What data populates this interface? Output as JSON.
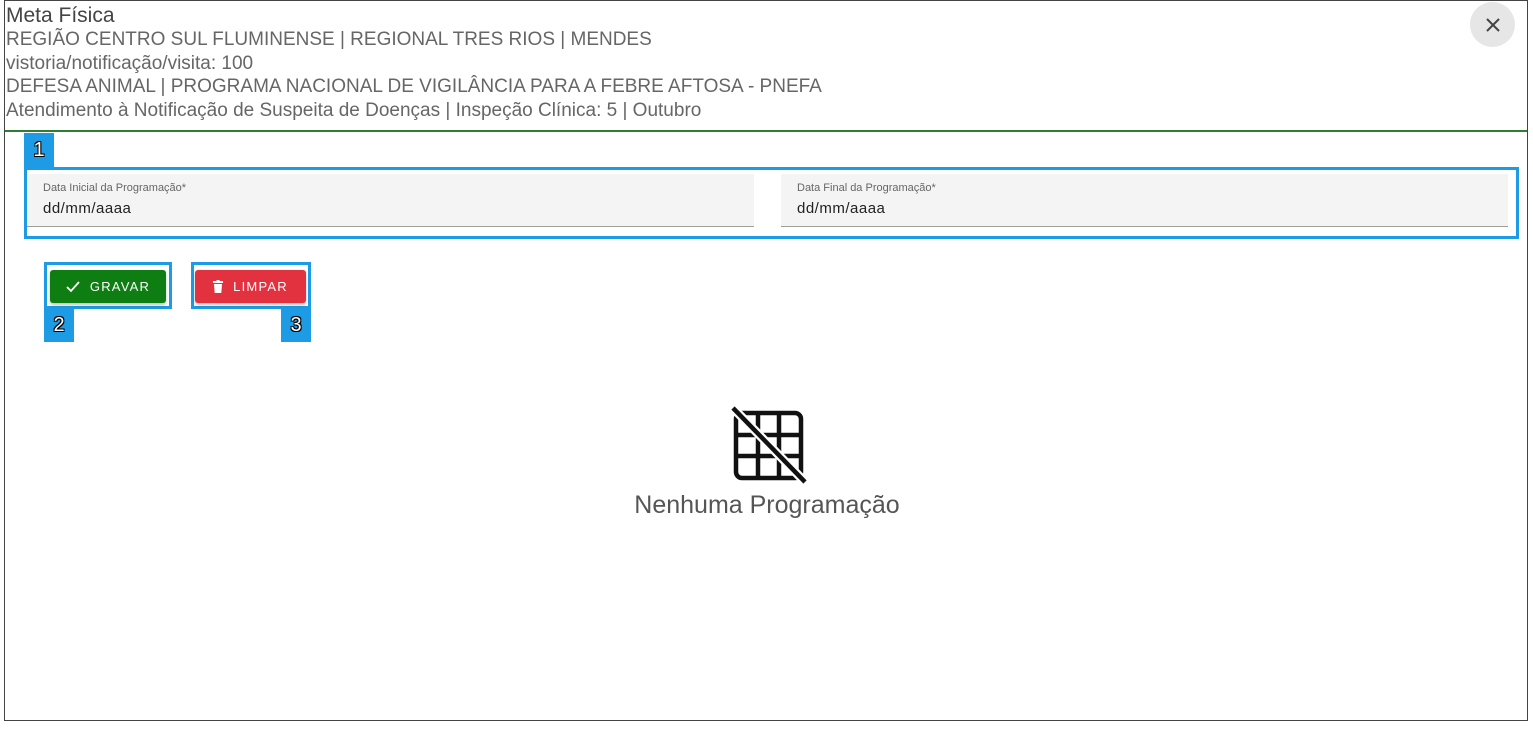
{
  "header": {
    "title": "Meta Física",
    "lines": [
      "REGIÃO CENTRO SUL FLUMINENSE | REGIONAL TRES RIOS | MENDES",
      "vistoria/notificação/visita: 100",
      "DEFESA ANIMAL | PROGRAMA NACIONAL DE VIGILÂNCIA PARA A FEBRE AFTOSA - PNEFA",
      "Atendimento à Notificação de Suspeita de Doenças | Inspeção Clínica: 5 | Outubro"
    ],
    "close_icon": "close-icon"
  },
  "annotations": {
    "one": "1",
    "two": "2",
    "three": "3"
  },
  "form": {
    "start_date": {
      "label": "Data Inicial da Programação*",
      "value": "dd/mm/aaaa"
    },
    "end_date": {
      "label": "Data Final da Programação*",
      "value": "dd/mm/aaaa"
    }
  },
  "buttons": {
    "save_label": "GRAVAR",
    "save_icon": "check-icon",
    "clear_label": "LIMPAR",
    "clear_icon": "trash-icon"
  },
  "empty_state": {
    "icon": "grid-off-icon",
    "text": "Nenhuma Programação"
  },
  "colors": {
    "save": "#0e7d12",
    "clear": "#e2323f",
    "annotation": "#1e9be5",
    "header_divider": "#2e7d32"
  }
}
